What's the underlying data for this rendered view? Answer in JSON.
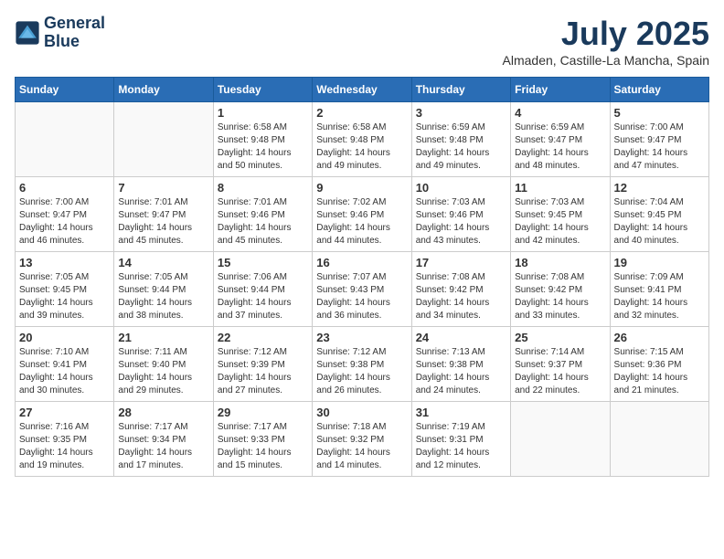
{
  "header": {
    "logo_line1": "General",
    "logo_line2": "Blue",
    "month": "July 2025",
    "location": "Almaden, Castille-La Mancha, Spain"
  },
  "days_of_week": [
    "Sunday",
    "Monday",
    "Tuesday",
    "Wednesday",
    "Thursday",
    "Friday",
    "Saturday"
  ],
  "weeks": [
    [
      {
        "day": "",
        "sunrise": "",
        "sunset": "",
        "daylight": ""
      },
      {
        "day": "",
        "sunrise": "",
        "sunset": "",
        "daylight": ""
      },
      {
        "day": "1",
        "sunrise": "Sunrise: 6:58 AM",
        "sunset": "Sunset: 9:48 PM",
        "daylight": "Daylight: 14 hours and 50 minutes."
      },
      {
        "day": "2",
        "sunrise": "Sunrise: 6:58 AM",
        "sunset": "Sunset: 9:48 PM",
        "daylight": "Daylight: 14 hours and 49 minutes."
      },
      {
        "day": "3",
        "sunrise": "Sunrise: 6:59 AM",
        "sunset": "Sunset: 9:48 PM",
        "daylight": "Daylight: 14 hours and 49 minutes."
      },
      {
        "day": "4",
        "sunrise": "Sunrise: 6:59 AM",
        "sunset": "Sunset: 9:47 PM",
        "daylight": "Daylight: 14 hours and 48 minutes."
      },
      {
        "day": "5",
        "sunrise": "Sunrise: 7:00 AM",
        "sunset": "Sunset: 9:47 PM",
        "daylight": "Daylight: 14 hours and 47 minutes."
      }
    ],
    [
      {
        "day": "6",
        "sunrise": "Sunrise: 7:00 AM",
        "sunset": "Sunset: 9:47 PM",
        "daylight": "Daylight: 14 hours and 46 minutes."
      },
      {
        "day": "7",
        "sunrise": "Sunrise: 7:01 AM",
        "sunset": "Sunset: 9:47 PM",
        "daylight": "Daylight: 14 hours and 45 minutes."
      },
      {
        "day": "8",
        "sunrise": "Sunrise: 7:01 AM",
        "sunset": "Sunset: 9:46 PM",
        "daylight": "Daylight: 14 hours and 45 minutes."
      },
      {
        "day": "9",
        "sunrise": "Sunrise: 7:02 AM",
        "sunset": "Sunset: 9:46 PM",
        "daylight": "Daylight: 14 hours and 44 minutes."
      },
      {
        "day": "10",
        "sunrise": "Sunrise: 7:03 AM",
        "sunset": "Sunset: 9:46 PM",
        "daylight": "Daylight: 14 hours and 43 minutes."
      },
      {
        "day": "11",
        "sunrise": "Sunrise: 7:03 AM",
        "sunset": "Sunset: 9:45 PM",
        "daylight": "Daylight: 14 hours and 42 minutes."
      },
      {
        "day": "12",
        "sunrise": "Sunrise: 7:04 AM",
        "sunset": "Sunset: 9:45 PM",
        "daylight": "Daylight: 14 hours and 40 minutes."
      }
    ],
    [
      {
        "day": "13",
        "sunrise": "Sunrise: 7:05 AM",
        "sunset": "Sunset: 9:45 PM",
        "daylight": "Daylight: 14 hours and 39 minutes."
      },
      {
        "day": "14",
        "sunrise": "Sunrise: 7:05 AM",
        "sunset": "Sunset: 9:44 PM",
        "daylight": "Daylight: 14 hours and 38 minutes."
      },
      {
        "day": "15",
        "sunrise": "Sunrise: 7:06 AM",
        "sunset": "Sunset: 9:44 PM",
        "daylight": "Daylight: 14 hours and 37 minutes."
      },
      {
        "day": "16",
        "sunrise": "Sunrise: 7:07 AM",
        "sunset": "Sunset: 9:43 PM",
        "daylight": "Daylight: 14 hours and 36 minutes."
      },
      {
        "day": "17",
        "sunrise": "Sunrise: 7:08 AM",
        "sunset": "Sunset: 9:42 PM",
        "daylight": "Daylight: 14 hours and 34 minutes."
      },
      {
        "day": "18",
        "sunrise": "Sunrise: 7:08 AM",
        "sunset": "Sunset: 9:42 PM",
        "daylight": "Daylight: 14 hours and 33 minutes."
      },
      {
        "day": "19",
        "sunrise": "Sunrise: 7:09 AM",
        "sunset": "Sunset: 9:41 PM",
        "daylight": "Daylight: 14 hours and 32 minutes."
      }
    ],
    [
      {
        "day": "20",
        "sunrise": "Sunrise: 7:10 AM",
        "sunset": "Sunset: 9:41 PM",
        "daylight": "Daylight: 14 hours and 30 minutes."
      },
      {
        "day": "21",
        "sunrise": "Sunrise: 7:11 AM",
        "sunset": "Sunset: 9:40 PM",
        "daylight": "Daylight: 14 hours and 29 minutes."
      },
      {
        "day": "22",
        "sunrise": "Sunrise: 7:12 AM",
        "sunset": "Sunset: 9:39 PM",
        "daylight": "Daylight: 14 hours and 27 minutes."
      },
      {
        "day": "23",
        "sunrise": "Sunrise: 7:12 AM",
        "sunset": "Sunset: 9:38 PM",
        "daylight": "Daylight: 14 hours and 26 minutes."
      },
      {
        "day": "24",
        "sunrise": "Sunrise: 7:13 AM",
        "sunset": "Sunset: 9:38 PM",
        "daylight": "Daylight: 14 hours and 24 minutes."
      },
      {
        "day": "25",
        "sunrise": "Sunrise: 7:14 AM",
        "sunset": "Sunset: 9:37 PM",
        "daylight": "Daylight: 14 hours and 22 minutes."
      },
      {
        "day": "26",
        "sunrise": "Sunrise: 7:15 AM",
        "sunset": "Sunset: 9:36 PM",
        "daylight": "Daylight: 14 hours and 21 minutes."
      }
    ],
    [
      {
        "day": "27",
        "sunrise": "Sunrise: 7:16 AM",
        "sunset": "Sunset: 9:35 PM",
        "daylight": "Daylight: 14 hours and 19 minutes."
      },
      {
        "day": "28",
        "sunrise": "Sunrise: 7:17 AM",
        "sunset": "Sunset: 9:34 PM",
        "daylight": "Daylight: 14 hours and 17 minutes."
      },
      {
        "day": "29",
        "sunrise": "Sunrise: 7:17 AM",
        "sunset": "Sunset: 9:33 PM",
        "daylight": "Daylight: 14 hours and 15 minutes."
      },
      {
        "day": "30",
        "sunrise": "Sunrise: 7:18 AM",
        "sunset": "Sunset: 9:32 PM",
        "daylight": "Daylight: 14 hours and 14 minutes."
      },
      {
        "day": "31",
        "sunrise": "Sunrise: 7:19 AM",
        "sunset": "Sunset: 9:31 PM",
        "daylight": "Daylight: 14 hours and 12 minutes."
      },
      {
        "day": "",
        "sunrise": "",
        "sunset": "",
        "daylight": ""
      },
      {
        "day": "",
        "sunrise": "",
        "sunset": "",
        "daylight": ""
      }
    ]
  ]
}
